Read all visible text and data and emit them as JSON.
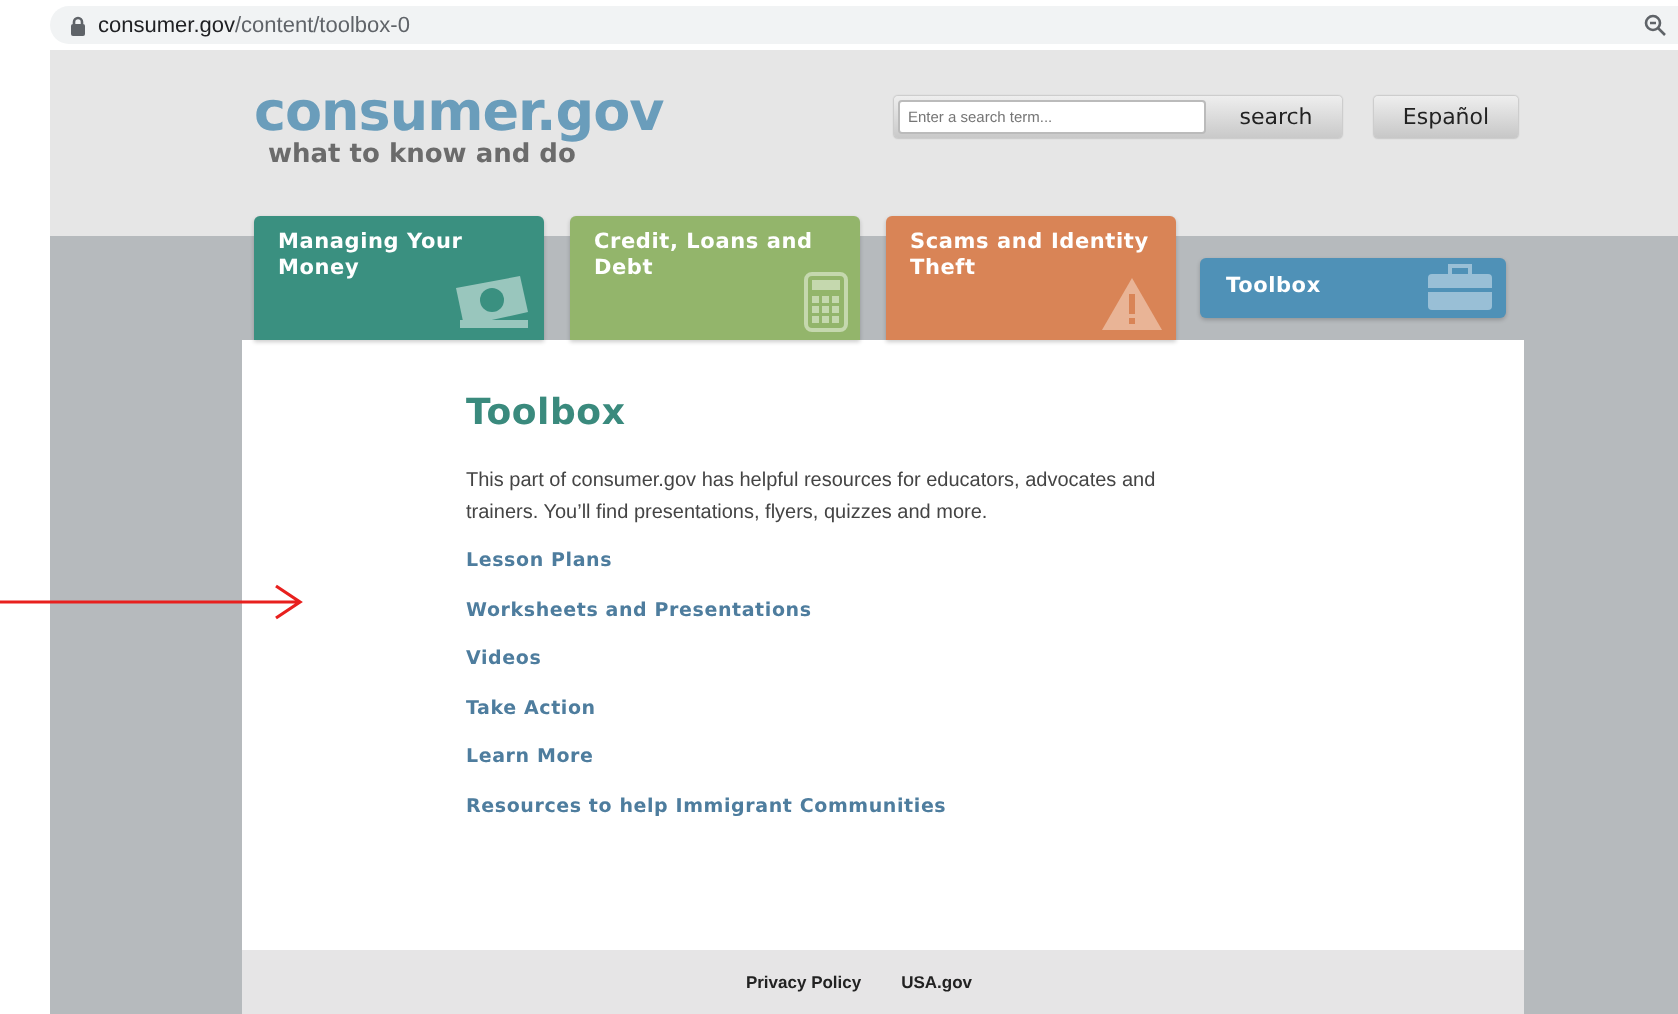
{
  "address_bar": {
    "host": "consumer.gov",
    "path": "/content/toolbox-0"
  },
  "header": {
    "logo_title": "consumer.gov",
    "logo_tagline": "what to know and do",
    "search": {
      "placeholder": "Enter a search term...",
      "button": "search"
    },
    "language_button": "Español"
  },
  "nav_tabs": [
    {
      "label": "Managing Your Money",
      "kind": "money",
      "color": "#3a9080",
      "selected": false
    },
    {
      "label": "Credit, Loans and Debt",
      "kind": "calculator",
      "color": "#93b56b",
      "selected": false
    },
    {
      "label": "Scams and Identity Theft",
      "kind": "warning",
      "color": "#d98456",
      "selected": false
    },
    {
      "label": "Toolbox",
      "kind": "toolbox",
      "color": "#4f91b7",
      "selected": true
    }
  ],
  "content": {
    "heading": "Toolbox",
    "intro": "This part of consumer.gov has helpful resources for educators, advocates and trainers. You’ll find presentations, flyers, quizzes and more.",
    "links": [
      "Lesson Plans",
      "Worksheets and Presentations",
      "Videos",
      "Take Action",
      "Learn More",
      "Resources to help Immigrant Communities"
    ]
  },
  "footer": {
    "links": [
      "Privacy Policy",
      "USA.gov"
    ]
  }
}
